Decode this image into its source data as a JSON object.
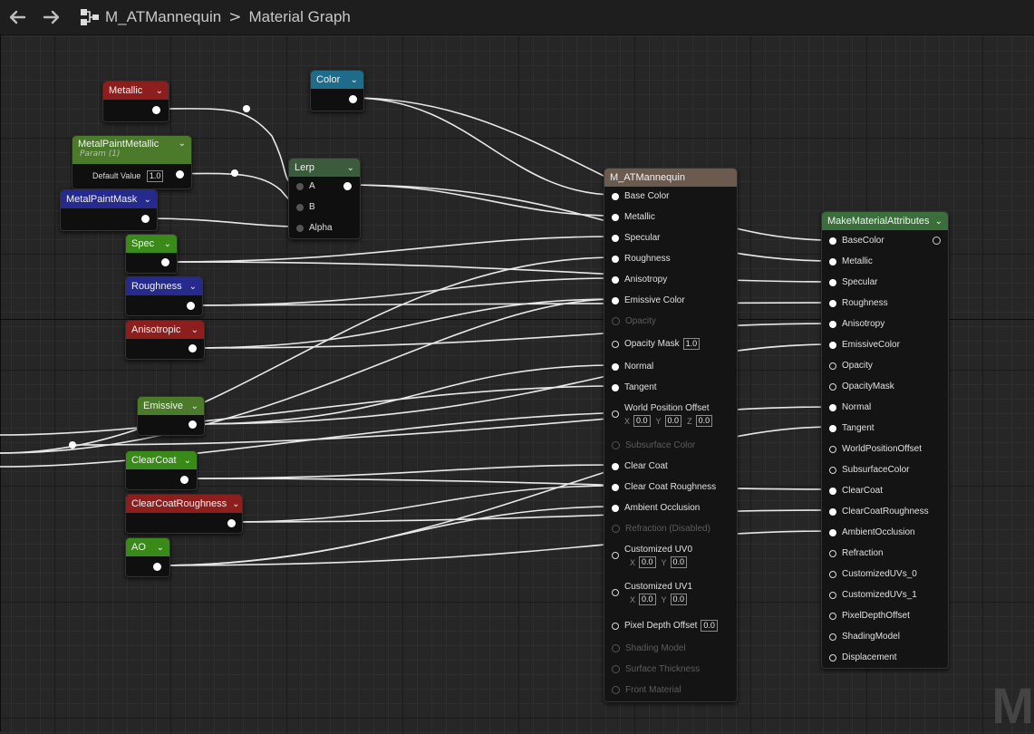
{
  "toolbar": {
    "back_icon": "arrow-left-icon",
    "forward_icon": "arrow-right-icon",
    "graph_icon": "node-graph-icon",
    "breadcrumb_root": "M_ATMannequin",
    "breadcrumb_sep": ">",
    "breadcrumb_current": "Material Graph"
  },
  "colors": {
    "red": "#8c1e1e",
    "green": "#3a8a1a",
    "blue": "#262a8c",
    "teal": "#1f6c8a",
    "material": "#6b5a4e",
    "make_attrs": "#3a6e3a"
  },
  "nodes": {
    "metallic": {
      "title": "Metallic"
    },
    "color": {
      "title": "Color"
    },
    "metal_paint_metallic": {
      "title": "MetalPaintMetallic",
      "subtitle": "Param (1)",
      "default_label": "Default Value",
      "default_value": "1.0"
    },
    "metal_paint_mask": {
      "title": "MetalPaintMask"
    },
    "lerp": {
      "title": "Lerp",
      "a": "A",
      "b": "B",
      "alpha": "Alpha"
    },
    "spec": {
      "title": "Spec"
    },
    "roughness": {
      "title": "Roughness"
    },
    "anisotropic": {
      "title": "Anisotropic"
    },
    "emissive": {
      "title": "Emissive"
    },
    "clearcoat": {
      "title": "ClearCoat"
    },
    "clearcoat_roughness": {
      "title": "ClearCoatRoughness"
    },
    "ao": {
      "title": "AO"
    }
  },
  "material": {
    "title": "M_ATMannequin",
    "base_color": "Base Color",
    "metallic": "Metallic",
    "specular": "Specular",
    "roughness": "Roughness",
    "anisotropy": "Anisotropy",
    "emissive": "Emissive Color",
    "opacity": "Opacity",
    "opacity_mask": "Opacity Mask",
    "opacity_mask_value": "1.0",
    "normal": "Normal",
    "tangent": "Tangent",
    "wpo": "World Position Offset",
    "axis_x": "X",
    "axis_y": "Y",
    "axis_z": "Z",
    "zero": "0.0",
    "subsurface": "Subsurface Color",
    "clear_coat": "Clear Coat",
    "clear_coat_roughness": "Clear Coat Roughness",
    "ambient_occlusion": "Ambient Occlusion",
    "refraction": "Refraction (Disabled)",
    "customized_uv0": "Customized UV0",
    "customized_uv1": "Customized UV1",
    "pixel_depth": "Pixel Depth Offset",
    "pixel_depth_value": "0.0",
    "shading_model": "Shading Model",
    "surface_thickness": "Surface Thickness",
    "front_material": "Front Material"
  },
  "make_attrs": {
    "title": "MakeMaterialAttributes",
    "pins": [
      "BaseColor",
      "Metallic",
      "Specular",
      "Roughness",
      "Anisotropy",
      "EmissiveColor",
      "Opacity",
      "OpacityMask",
      "Normal",
      "Tangent",
      "WorldPositionOffset",
      "SubsurfaceColor",
      "ClearCoat",
      "ClearCoatRoughness",
      "AmbientOcclusion",
      "Refraction",
      "CustomizedUVs_0",
      "CustomizedUVs_1",
      "PixelDepthOffset",
      "ShadingModel",
      "Displacement"
    ]
  },
  "watermark": "M"
}
